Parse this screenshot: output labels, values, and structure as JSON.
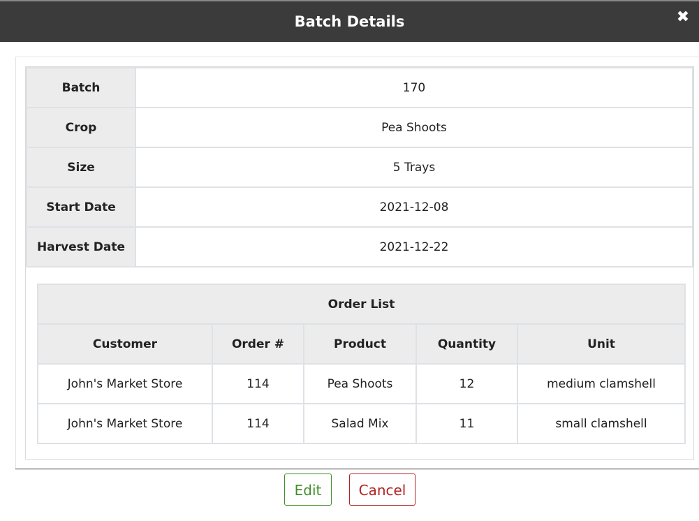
{
  "dialog": {
    "title": "Batch Details",
    "close_glyph": "✖"
  },
  "details": [
    {
      "label": "Batch",
      "value": "170"
    },
    {
      "label": "Crop",
      "value": "Pea Shoots"
    },
    {
      "label": "Size",
      "value": "5 Trays"
    },
    {
      "label": "Start Date",
      "value": "2021-12-08"
    },
    {
      "label": "Harvest Date",
      "value": "2021-12-22"
    }
  ],
  "orders": {
    "title": "Order List",
    "columns": [
      "Customer",
      "Order #",
      "Product",
      "Quantity",
      "Unit"
    ],
    "rows": [
      [
        "John's Market Store",
        "114",
        "Pea Shoots",
        "12",
        "medium clamshell"
      ],
      [
        "John's Market Store",
        "114",
        "Salad Mix",
        "11",
        "small clamshell"
      ]
    ]
  },
  "actions": {
    "edit_label": "Edit",
    "cancel_label": "Cancel"
  },
  "colors": {
    "titlebar": "#3b3b3b",
    "header_cell": "#ececec",
    "edit": "#3f8f2a",
    "cancel": "#b22222"
  },
  "icons": {
    "close": "close-icon"
  }
}
